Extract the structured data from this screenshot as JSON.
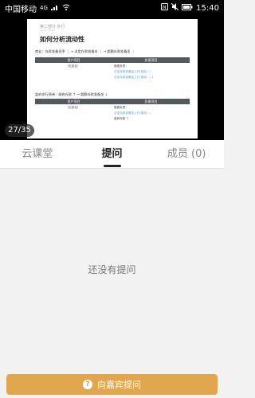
{
  "status_bar": {
    "carrier": "中国移动",
    "network": "4G",
    "time": "15:40"
  },
  "slide": {
    "subtitle": "第二部分 外行",
    "subtitle2": "Lorem ipsum",
    "title": "如何分析流动性",
    "line1": "商业：存款准备金率 ｜ → 法定存款准备金 ｜ → 超额存款准备金 ｜",
    "table1": {
      "headers": [
        "资产项目",
        "负债项目"
      ],
      "left": "（无变化）",
      "right": [
        "缴费负债：",
        "法定存款准备金上升(增加...)",
        "法定存款准备金上升(增加...) ↓"
      ]
    },
    "line2": "监府发行债券：政府存款 ↑ → 超额存款准备金 ↓",
    "table2": {
      "headers": [
        "资产项目",
        "负债项目"
      ],
      "left": "（无变化）",
      "right": [
        "缴费负债：",
        "法定存款准备金上升(增加...)",
        "政府存款 ↑"
      ]
    }
  },
  "counter": "27/35",
  "tabs": [
    {
      "label": "云课堂",
      "active": false
    },
    {
      "label": "提问",
      "active": true
    },
    {
      "label": "成员 (0)",
      "active": false
    }
  ],
  "empty_text": "还没有提问",
  "ask_button": {
    "icon": "?",
    "label": "向嘉宾提问"
  },
  "colors": {
    "accent": "#e2a64e",
    "background": "#f2f2f2"
  }
}
